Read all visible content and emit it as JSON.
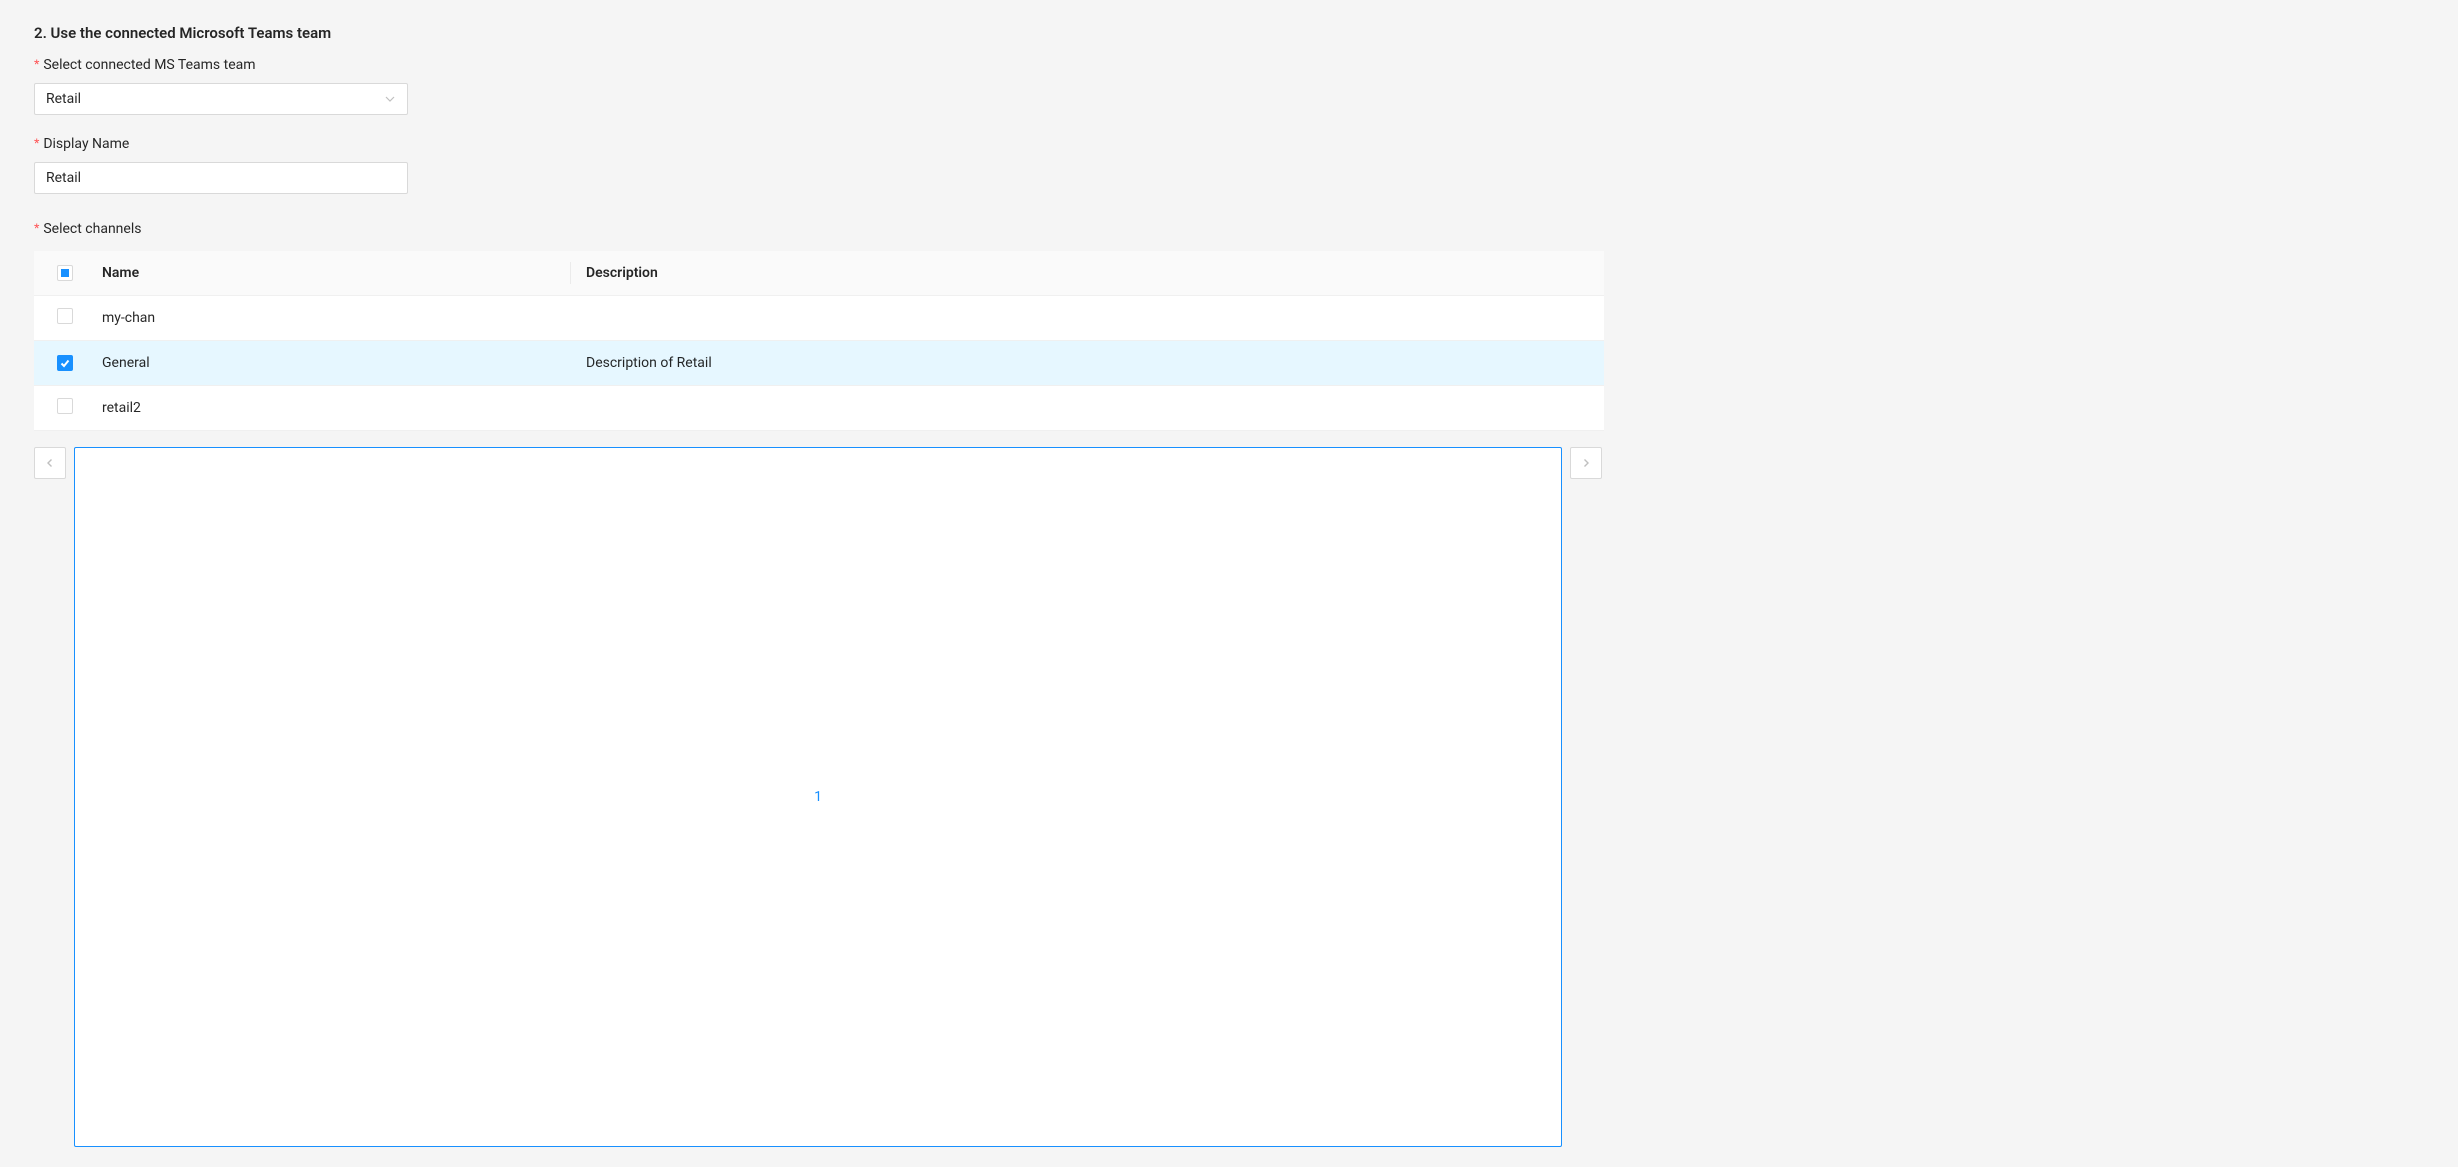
{
  "section": {
    "heading": "2. Use the connected Microsoft Teams team"
  },
  "fields": {
    "team_label": "Select connected MS Teams team",
    "team_value": "Retail",
    "display_name_label": "Display Name",
    "display_name_value": "Retail",
    "channels_label": "Select channels"
  },
  "table": {
    "columns": {
      "name": "Name",
      "description": "Description"
    },
    "rows": [
      {
        "name": "my-chan",
        "description": "",
        "checked": false
      },
      {
        "name": "General",
        "description": "Description of Retail",
        "checked": true
      },
      {
        "name": "retail2",
        "description": "",
        "checked": false
      }
    ],
    "header_check_state": "indeterminate"
  },
  "pagination": {
    "current": "1",
    "prev_enabled": false,
    "next_enabled": false
  }
}
